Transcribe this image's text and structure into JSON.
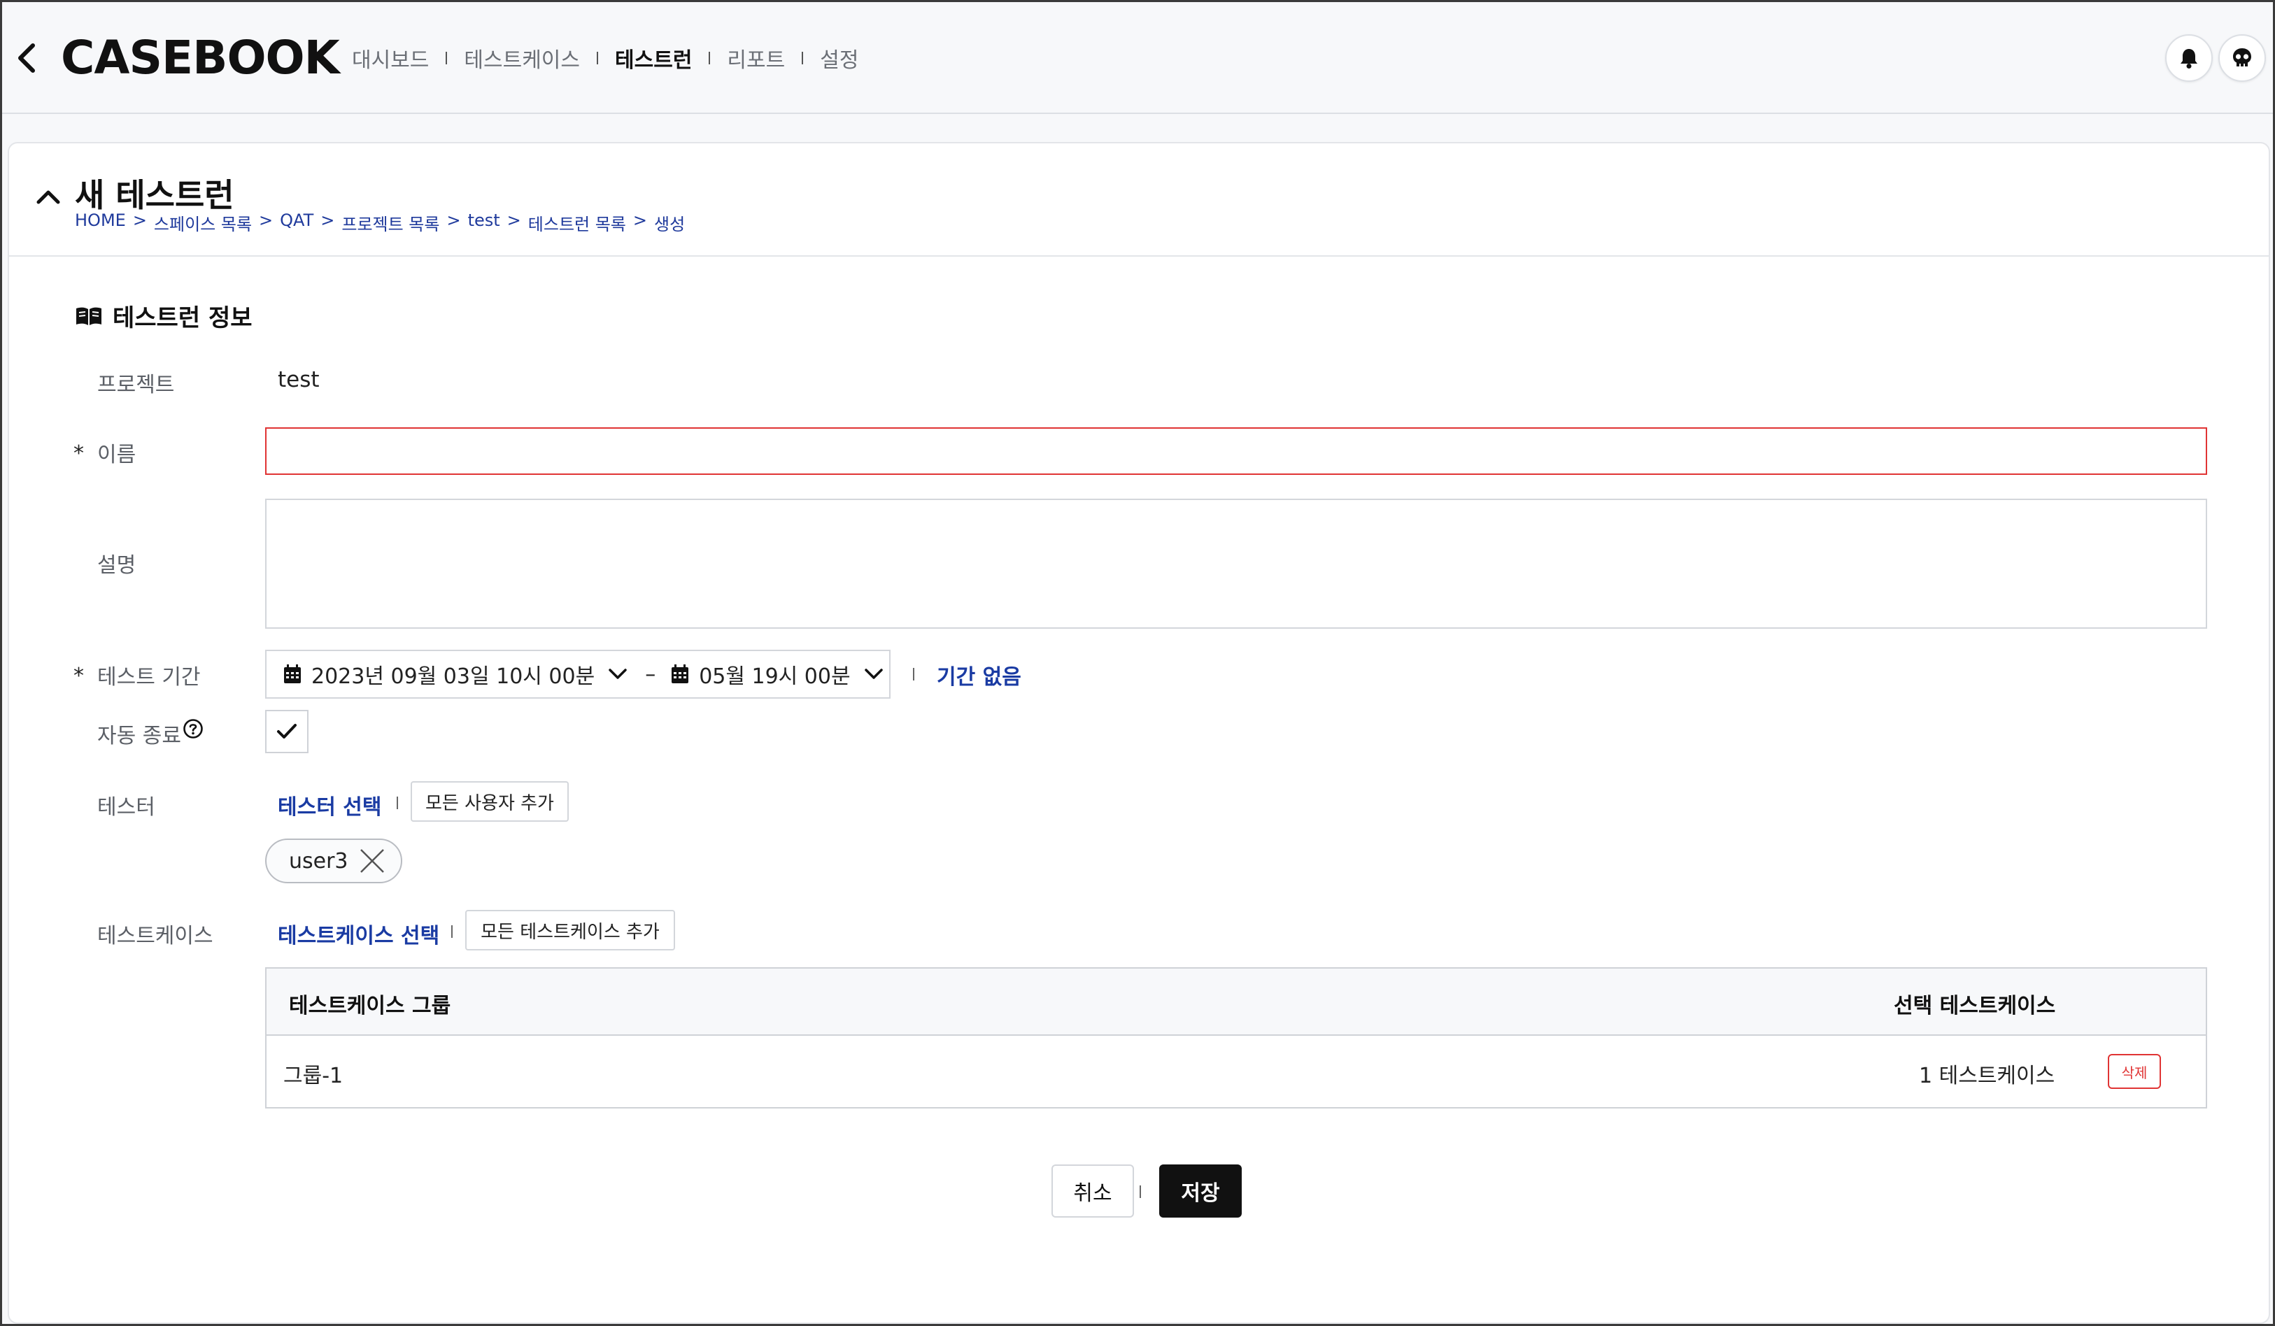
{
  "header": {
    "logo": "CASEBOOK",
    "nav": [
      {
        "label": "대시보드",
        "active": false
      },
      {
        "label": "테스트케이스",
        "active": false
      },
      {
        "label": "테스트런",
        "active": true
      },
      {
        "label": "리포트",
        "active": false
      },
      {
        "label": "설정",
        "active": false
      }
    ],
    "icons": [
      "bell-icon",
      "skull-avatar-icon"
    ]
  },
  "page": {
    "title": "새 테스트런",
    "breadcrumb": [
      "HOME",
      "스페이스 목록",
      "QAT",
      "프로젝트 목록",
      "test",
      "테스트런 목록",
      "생성"
    ],
    "breadcrumb_separator": ">"
  },
  "section": {
    "title": "테스트런 정보",
    "icon": "book-open-icon"
  },
  "form": {
    "required_mark": "*",
    "project": {
      "label": "프로젝트",
      "value": "test"
    },
    "name": {
      "label": "이름",
      "value": "",
      "placeholder": ""
    },
    "description": {
      "label": "설명",
      "value": "",
      "placeholder": ""
    },
    "period": {
      "label": "테스트 기간",
      "start": "2023년 09월 03일 10시 00분",
      "dash": "–",
      "end": "05월 19시 00분",
      "no_period_link": "기간 없음"
    },
    "auto_end": {
      "label": "자동 종료",
      "checked": true
    },
    "tester": {
      "label": "테스터",
      "select_link": "테스터 선택",
      "add_all_button": "모든 사용자 추가",
      "chips": [
        "user3"
      ]
    },
    "testcase": {
      "label": "테스트케이스",
      "select_link": "테스트케이스 선택",
      "add_all_button": "모든 테스트케이스 추가",
      "table": {
        "headers": [
          "테스트케이스 그룹",
          "선택 테스트케이스"
        ],
        "rows": [
          {
            "group": "그룹-1",
            "count": "1 테스트케이스",
            "delete": "삭제"
          }
        ]
      }
    }
  },
  "footer": {
    "cancel": "취소",
    "save": "저장"
  },
  "colors": {
    "accent_link": "#1a3ba3",
    "error": "#e03434",
    "primary_button": "#111111"
  }
}
